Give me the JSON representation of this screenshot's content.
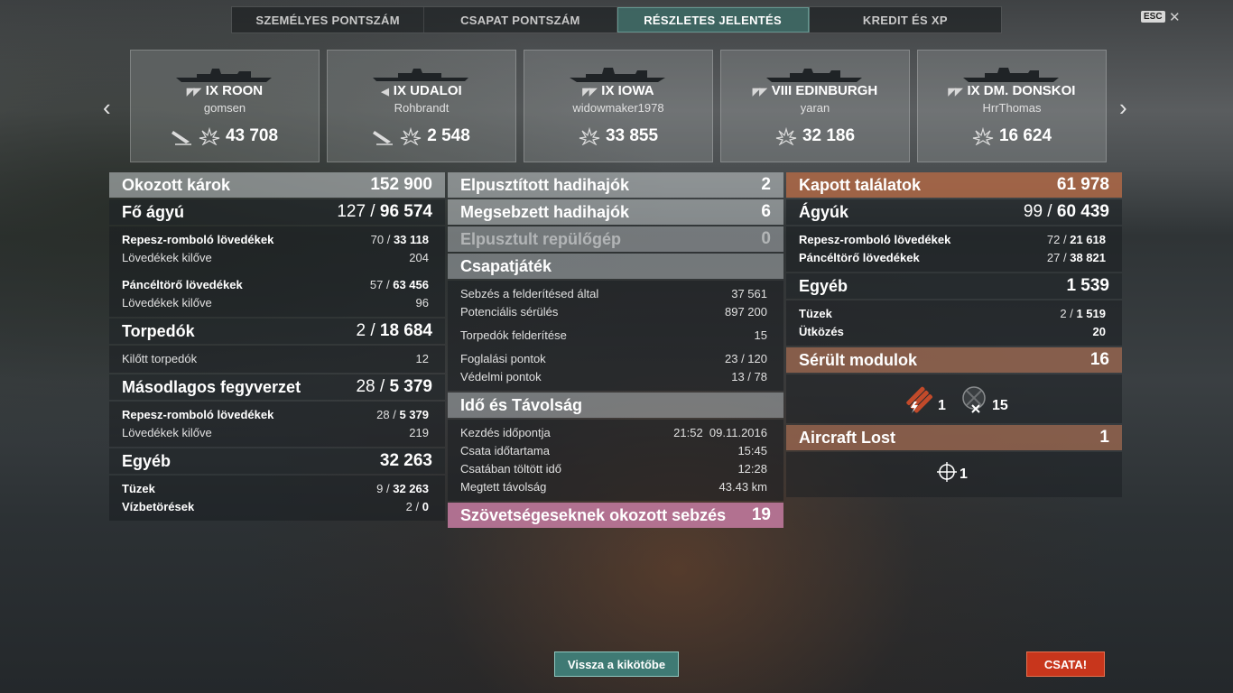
{
  "tabs": [
    {
      "label": "SZEMÉLYES PONTSZÁM",
      "active": false
    },
    {
      "label": "CSAPAT PONTSZÁM",
      "active": false
    },
    {
      "label": "RÉSZLETES JELENTÉS",
      "active": true
    },
    {
      "label": "KREDIT ÉS XP",
      "active": false
    }
  ],
  "esc_label": "ESC",
  "cards": [
    {
      "tier": "IX",
      "ship": "ROON",
      "player": "gomsen",
      "score": "43 708"
    },
    {
      "tier": "IX",
      "ship": "UDALOI",
      "player": "Rohbrandt",
      "score": "2 548"
    },
    {
      "tier": "IX",
      "ship": "IOWA",
      "player": "widowmaker1978",
      "score": "33 855"
    },
    {
      "tier": "VIII",
      "ship": "EDINBURGH",
      "player": "yaran",
      "score": "32 186"
    },
    {
      "tier": "IX",
      "ship": "DM. DONSKOI",
      "player": "HrrThomas",
      "score": "16 624"
    }
  ],
  "left": {
    "damage_label": "Okozott károk",
    "damage_value": "152 900",
    "main": {
      "label": "Fő ágyú",
      "hits": "127 /",
      "dmg": "96 574"
    },
    "he_label": "Repesz-romboló lövedékek",
    "he_hits": "70 /",
    "he_dmg": "33 118",
    "he_shots_label": "Lövedékek kilőve",
    "he_shots": "204",
    "ap_label": "Páncéltörő lövedékek",
    "ap_hits": "57 /",
    "ap_dmg": "63 456",
    "ap_shots_label": "Lövedékek kilőve",
    "ap_shots": "96",
    "torp": {
      "label": "Torpedók",
      "hits": "2 /",
      "dmg": "18 684"
    },
    "torp_fired_label": "Kilőtt torpedók",
    "torp_fired": "12",
    "sec": {
      "label": "Másodlagos fegyverzet",
      "hits": "28 /",
      "dmg": "5 379"
    },
    "sec_he_label": "Repesz-romboló lövedékek",
    "sec_he_hits": "28 /",
    "sec_he_dmg": "5 379",
    "sec_shots_label": "Lövedékek kilőve",
    "sec_shots": "219",
    "other": {
      "label": "Egyéb",
      "value": "32 263"
    },
    "fires_label": "Tüzek",
    "fires_hits": "9 /",
    "fires_dmg": "32 263",
    "flood_label": "Vízbetörések",
    "flood_hits": "2 /",
    "flood_dmg": "0"
  },
  "middle": {
    "destroyed_label": "Elpusztított hadihajók",
    "destroyed": "2",
    "damaged_label": "Megsebzett hadihajók",
    "damaged": "6",
    "planes_label": "Elpusztult repülőgép",
    "planes": "0",
    "team_label": "Csapatjáték",
    "team_rows": [
      {
        "label": "Sebzés a felderítésed által",
        "value": "37 561"
      },
      {
        "label": "Potenciális sérülés",
        "value": "897 200"
      },
      {
        "label": "Torpedók felderítése",
        "value": "15"
      },
      {
        "label": "Foglalási pontok",
        "value": "23 / 120"
      },
      {
        "label": "Védelmi pontok",
        "value": "13 / 78"
      }
    ],
    "time_label": "Idő és Távolság",
    "time_rows": [
      {
        "label": "Kezdés időpontja",
        "value": "21:52  09.11.2016"
      },
      {
        "label": "Csata időtartama",
        "value": "15:45"
      },
      {
        "label": "Csatában töltött idő",
        "value": "12:28"
      },
      {
        "label": "Megtett távolság",
        "value": "43.43 km"
      }
    ],
    "ally_label": "Szövetségeseknek okozott sebzés",
    "ally_value": "19"
  },
  "right": {
    "received_label": "Kapott találatok",
    "received": "61 978",
    "guns": {
      "label": "Ágyúk",
      "hits": "99 /",
      "dmg": "60 439"
    },
    "he_label": "Repesz-romboló lövedékek",
    "he_hits": "72 /",
    "he_dmg": "21 618",
    "ap_label": "Páncéltörő lövedékek",
    "ap_hits": "27 /",
    "ap_dmg": "38 821",
    "other": {
      "label": "Egyéb",
      "value": "1 539"
    },
    "fires_label": "Tüzek",
    "fires_hits": "2 /",
    "fires_dmg": "1 519",
    "ram_label": "Ütközés",
    "ram_value": "20",
    "modules_label": "Sérült modulok",
    "modules": "16",
    "mod_torp": "1",
    "mod_gun": "15",
    "aircraft_label": "Aircraft Lost",
    "aircraft": "1",
    "aircraft_icon_count": "1"
  },
  "buttons": {
    "back": "Vissza a kikötőbe",
    "battle": "CSATA!"
  },
  "colors": {
    "accent_teal": "#3f7a74",
    "battle_red": "#c8361c",
    "received_orange": "#b06945",
    "ally_pink": "#be789b"
  }
}
